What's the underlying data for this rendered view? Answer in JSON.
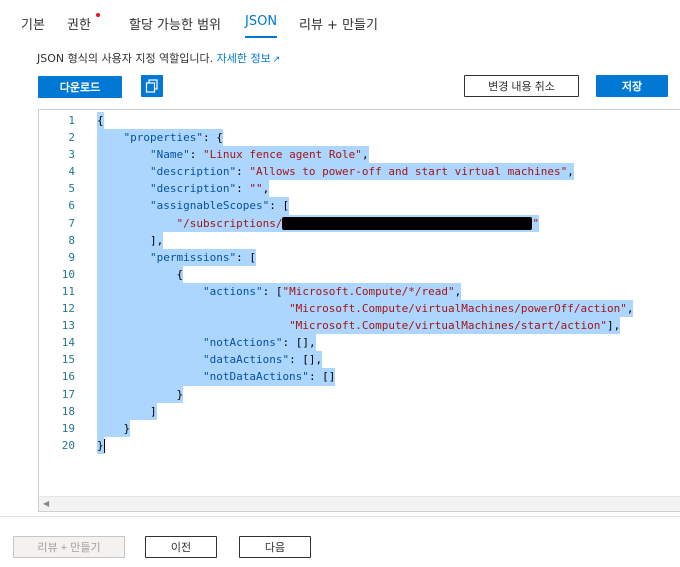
{
  "tabs": [
    {
      "label": "기본"
    },
    {
      "label": "권한"
    },
    {
      "label": "할당 가능한 범위"
    },
    {
      "label": "JSON"
    },
    {
      "label": "리뷰 + 만들기"
    }
  ],
  "description": {
    "text": "JSON 형식의 사용자 지정 역할입니다.",
    "link": "자세한 정보"
  },
  "toolbar": {
    "download_label": "다운로드",
    "discard_label": "변경 내용 취소",
    "save_label": "저장"
  },
  "editor": {
    "line_numbers": [
      "1",
      "2",
      "3",
      "4",
      "5",
      "6",
      "7",
      "8",
      "9",
      "10",
      "11",
      "12",
      "13",
      "14",
      "15",
      "16",
      "17",
      "18",
      "19",
      "20"
    ],
    "properties_key": "\"properties\"",
    "name_key": "\"Name\"",
    "name_value": "\"Linux fence agent Role\"",
    "description_key": "\"description\"",
    "description_value": "\"Allows to power-off and start virtual machines\"",
    "description_empty": "\"\"",
    "assignable_key": "\"assignableScopes\"",
    "subscription_prefix": "\"/subscriptions/",
    "permissions_key": "\"permissions\"",
    "actions_key": "\"actions\"",
    "action_1": "\"Microsoft.Compute/*/read\"",
    "action_2": "\"Microsoft.Compute/virtualMachines/powerOff/action\"",
    "action_3": "\"Microsoft.Compute/virtualMachines/start/action\"",
    "not_actions_key": "\"notActions\"",
    "data_actions_key": "\"dataActions\"",
    "not_data_actions_key": "\"notDataActions\""
  },
  "footer": {
    "review_create_label": "리뷰 + 만들기",
    "previous_label": "이전",
    "next_label": "다음"
  },
  "colors": {
    "accent": "#0078d4",
    "selection": "#add6ff",
    "required_dot": "#e81123"
  }
}
